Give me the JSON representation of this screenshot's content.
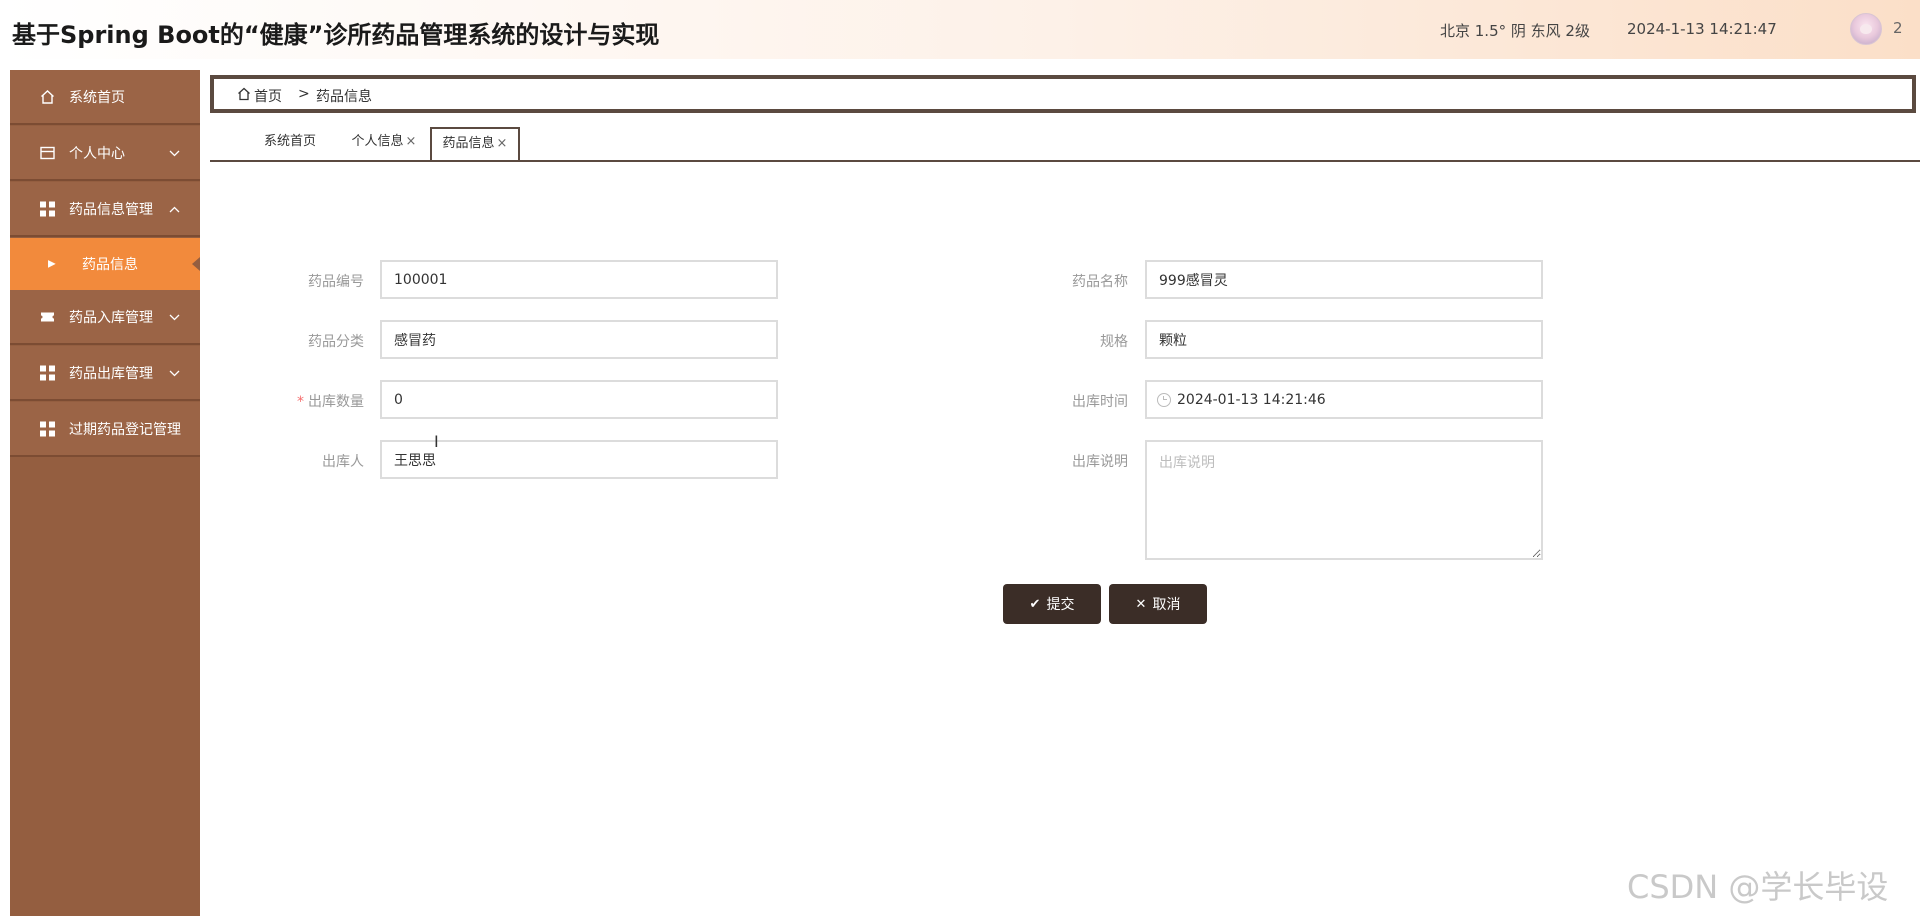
{
  "header": {
    "title": "基于Spring Boot的“健康”诊所药品管理系统的设计与实现",
    "weather": "北京  1.5°  阴  东风  2级",
    "datetime": "2024-1-13 14:21:47",
    "user_count": "2"
  },
  "sidebar": {
    "items": [
      {
        "label": "系统首页",
        "icon": "home-icon"
      },
      {
        "label": "个人中心",
        "icon": "card-icon",
        "arrow": "chevron-down"
      },
      {
        "label": "药品信息管理",
        "icon": "grid-icon",
        "arrow": "chevron-up"
      },
      {
        "label": "药品入库管理",
        "icon": "ticket-icon",
        "arrow": "chevron-down"
      },
      {
        "label": "药品出库管理",
        "icon": "grid-icon",
        "arrow": "chevron-down"
      },
      {
        "label": "过期药品登记管理",
        "icon": "grid-icon"
      }
    ],
    "active_subitem": "药品信息"
  },
  "breadcrumb": {
    "home": "首页",
    "separator": ">",
    "current": "药品信息"
  },
  "tabs": [
    {
      "label": "系统首页"
    },
    {
      "label": "个人信息",
      "close": "×"
    },
    {
      "label": "药品信息",
      "close": "×"
    }
  ],
  "form": {
    "drug_code": {
      "label": "药品编号",
      "value": "100001"
    },
    "drug_name": {
      "label": "药品名称",
      "value": "999感冒灵"
    },
    "drug_category": {
      "label": "药品分类",
      "value": "感冒药"
    },
    "spec": {
      "label": "规格",
      "value": "颗粒"
    },
    "out_quantity": {
      "label": "出库数量",
      "required_mark": "*",
      "value": "0"
    },
    "out_time": {
      "label": "出库时间",
      "value": "2024-01-13 14:21:46"
    },
    "out_person": {
      "label": "出库人",
      "value": "王思思"
    },
    "out_note": {
      "label": "出库说明",
      "placeholder": "出库说明",
      "value": ""
    }
  },
  "buttons": {
    "submit": "提交",
    "cancel": "取消"
  },
  "watermark": "CSDN @学长毕设",
  "colors": {
    "sidebar": "#945e40",
    "active_item": "#f28a3c",
    "button": "#3b2d27",
    "border_dark": "#5b4a40"
  }
}
